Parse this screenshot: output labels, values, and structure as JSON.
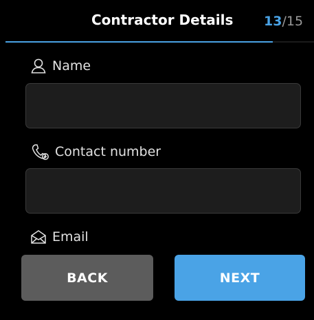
{
  "header": {
    "title": "Contractor Details",
    "step_current": "13",
    "step_separator": "/",
    "step_total": "15",
    "progress": 0.867
  },
  "form": {
    "name_label": "Name",
    "name_icon": "person-icon",
    "name_value": "",
    "contact_label": "Contact number",
    "contact_icon": "phone-icon",
    "contact_value": "",
    "email_label": "Email",
    "email_icon": "envelope-icon"
  },
  "buttons": {
    "back": "BACK",
    "next": "NEXT"
  },
  "colors": {
    "accent": "#4aa3e6",
    "background": "#000000",
    "back_button": "#5c5c5c"
  }
}
